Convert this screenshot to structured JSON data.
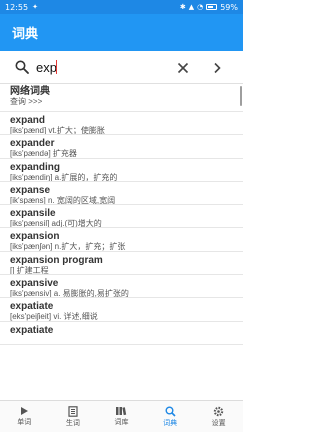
{
  "status": {
    "time": "12:55",
    "battery": "59%"
  },
  "appbar": {
    "title": "词典"
  },
  "search": {
    "value": "exp"
  },
  "net": {
    "title": "网络词典",
    "sub": "查询 >>>"
  },
  "results": [
    {
      "word": "expand",
      "def": "[iks'pænd] vt.扩大；使膨胀"
    },
    {
      "word": "expander",
      "def": "[iks'pændə] 扩充器"
    },
    {
      "word": "expanding",
      "def": "[iks'pændiŋ] a.扩展的，扩充的"
    },
    {
      "word": "expanse",
      "def": "[ik'spæns] n. 宽阔的区域,宽阔"
    },
    {
      "word": "expansile",
      "def": "[iks'pænsil] adj.(可)增大的"
    },
    {
      "word": "expansion",
      "def": "[iks'pænʃən] n.扩大，扩充；扩张"
    },
    {
      "word": "expansion program",
      "def": "[] 扩建工程"
    },
    {
      "word": "expansive",
      "def": "[iks'pænsiv] a. 易膨胀的,易扩张的"
    },
    {
      "word": "expatiate",
      "def": "[eks'peiʃieit] vi. 详述,细说"
    },
    {
      "word": "expatiate",
      "def": ""
    }
  ],
  "nav": [
    {
      "label": "单词",
      "icon": "play-icon"
    },
    {
      "label": "生词",
      "icon": "notebook-icon"
    },
    {
      "label": "词库",
      "icon": "books-icon"
    },
    {
      "label": "词典",
      "icon": "search-icon",
      "active": true
    },
    {
      "label": "设置",
      "icon": "gear-icon"
    }
  ],
  "colors": {
    "primary": "#2196f3",
    "status": "#1e88e5"
  }
}
